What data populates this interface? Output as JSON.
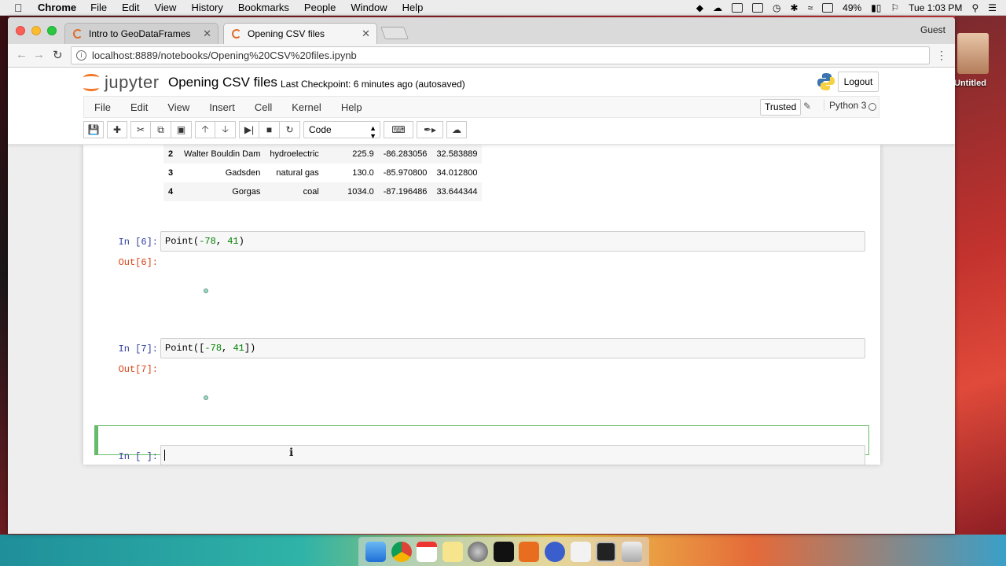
{
  "menubar": {
    "app": "Chrome",
    "items": [
      "File",
      "Edit",
      "View",
      "History",
      "Bookmarks",
      "People",
      "Window",
      "Help"
    ],
    "battery": "49%",
    "clock": "Tue 1:03 PM"
  },
  "browser": {
    "tabs": [
      {
        "title": "Intro to GeoDataFrames"
      },
      {
        "title": "Opening CSV files"
      }
    ],
    "profile": "Guest",
    "url": "localhost:8889/notebooks/Opening%20CSV%20files.ipynb"
  },
  "desktop": {
    "icon_label": "Untitled"
  },
  "jupyter": {
    "logo_text": "jupyter",
    "notebook_title": "Opening CSV files",
    "checkpoint": "Last Checkpoint: 6 minutes ago (autosaved)",
    "logout_label": "Logout",
    "menu": [
      "File",
      "Edit",
      "View",
      "Insert",
      "Cell",
      "Kernel",
      "Help"
    ],
    "trusted_label": "Trusted",
    "kernel_name": "Python 3",
    "cell_type": "Code"
  },
  "dataframe": {
    "rows": [
      {
        "idx": "2",
        "name": "Walter Bouldin Dam",
        "type": "hydroelectric",
        "capacity": "225.9",
        "lon": "-86.283056",
        "lat": "32.583889"
      },
      {
        "idx": "3",
        "name": "Gadsden",
        "type": "natural gas",
        "capacity": "130.0",
        "lon": "-85.970800",
        "lat": "34.012800"
      },
      {
        "idx": "4",
        "name": "Gorgas",
        "type": "coal",
        "capacity": "1034.0",
        "lon": "-87.196486",
        "lat": "33.644344"
      }
    ]
  },
  "cells": [
    {
      "in_prompt": "In [6]:",
      "code_prefix": "Point(",
      "code_num1": "-78",
      "code_sep": ", ",
      "code_num2": "41",
      "code_suffix": ")",
      "out_prompt": "Out[6]:"
    },
    {
      "in_prompt": "In [7]:",
      "code_prefix": "Point([",
      "code_num1": "-78",
      "code_sep": ", ",
      "code_num2": "41",
      "code_suffix": "])",
      "out_prompt": "Out[7]:"
    },
    {
      "in_prompt": "In [ ]:"
    }
  ]
}
